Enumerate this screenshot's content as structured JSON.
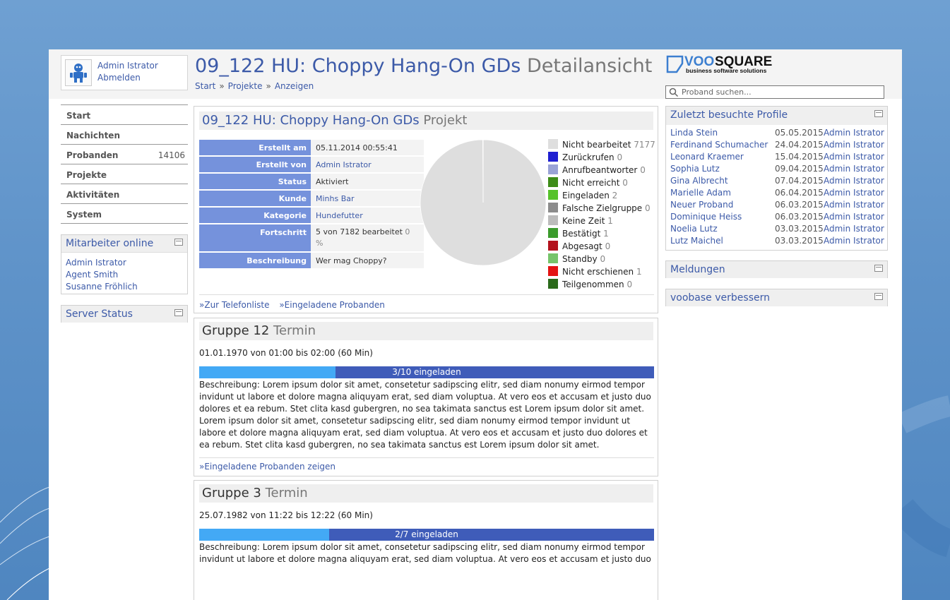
{
  "user": {
    "name": "Admin Istrator",
    "logout": "Abmelden"
  },
  "page": {
    "title": "09_122 HU: Choppy Hang-On GDs",
    "title_suffix": "Detailansicht"
  },
  "breadcrumb": [
    "Start",
    "Projekte",
    "Anzeigen"
  ],
  "breadcrumb_sep": "»",
  "logo": {
    "word_a": "VOO",
    "word_b": "SQUARE",
    "tagline": "business software solutions"
  },
  "search": {
    "placeholder": "Proband suchen..."
  },
  "nav": [
    {
      "label": "Start",
      "count": ""
    },
    {
      "label": "Nachichten",
      "count": ""
    },
    {
      "label": "Probanden",
      "count": "14106"
    },
    {
      "label": "Projekte",
      "count": ""
    },
    {
      "label": "Aktivitäten",
      "count": ""
    },
    {
      "label": "System",
      "count": ""
    }
  ],
  "online": {
    "title": "Mitarbeiter online",
    "users": [
      "Admin Istrator",
      "Agent Smith",
      "Susanne Fröhlich"
    ]
  },
  "server_status": {
    "title": "Server Status"
  },
  "project": {
    "name": "09_122 HU: Choppy Hang-On GDs",
    "suffix": "Projekt",
    "fields": [
      {
        "key": "Erstellt am",
        "value": "05.11.2014 00:55:41"
      },
      {
        "key": "Erstellt von",
        "value": "Admin Istrator"
      },
      {
        "key": "Status",
        "value": "Aktiviert"
      },
      {
        "key": "Kunde",
        "value": "Minhs Bar"
      },
      {
        "key": "Kategorie",
        "value": "Hundefutter"
      },
      {
        "key": "Fortschritt",
        "value": "5 von 7182 bearbeitet",
        "value_extra": "0 %"
      },
      {
        "key": "Beschreibung",
        "value": "Wer mag Choppy?"
      }
    ],
    "links": {
      "phone_list": "Zur Telefonliste",
      "invited": "Eingeladene Probanden"
    },
    "link_prefix": "»"
  },
  "chart_data": {
    "type": "pie",
    "slices": [
      {
        "label": "Nicht bearbeitet",
        "value": 7177,
        "color": "#dedede"
      },
      {
        "label": "Zurückrufen",
        "value": 0,
        "color": "#1f1fd1"
      },
      {
        "label": "Anrufbeantworter",
        "value": 0,
        "color": "#9aa3d6"
      },
      {
        "label": "Nicht erreicht",
        "value": 0,
        "color": "#3d8c18"
      },
      {
        "label": "Eingeladen",
        "value": 2,
        "color": "#56c22b"
      },
      {
        "label": "Falsche Zielgruppe",
        "value": 0,
        "color": "#8c8c8c"
      },
      {
        "label": "Keine Zeit",
        "value": 1,
        "color": "#bcbcbc"
      },
      {
        "label": "Bestätigt",
        "value": 1,
        "color": "#3b9b2c"
      },
      {
        "label": "Abgesagt",
        "value": 0,
        "color": "#b3121d"
      },
      {
        "label": "Standby",
        "value": 0,
        "color": "#76c46a"
      },
      {
        "label": "Nicht erschienen",
        "value": 1,
        "color": "#e31313"
      },
      {
        "label": "Teilgenommen",
        "value": 0,
        "color": "#2b6a1b"
      }
    ]
  },
  "groups": [
    {
      "name": "Gruppe 12",
      "suffix": "Termin",
      "date": "01.01.1970 von 01:00 bis 02:00 (60 Min)",
      "progress": {
        "invited": 3,
        "total": 10,
        "label": "3/10 eingeladen"
      },
      "description": "Beschreibung: Lorem ipsum dolor sit amet, consetetur sadipscing elitr, sed diam nonumy eirmod tempor invidunt ut labore et dolore magna aliquyam erat, sed diam voluptua. At vero eos et accusam et justo duo dolores et ea rebum. Stet clita kasd gubergren, no sea takimata sanctus est Lorem ipsum dolor sit amet. Lorem ipsum dolor sit amet, consetetur sadipscing elitr, sed diam nonumy eirmod tempor invidunt ut labore et dolore magna aliquyam erat, sed diam voluptua. At vero eos et accusam et justo duo dolores et ea rebum. Stet clita kasd gubergren, no sea takimata sanctus est Lorem ipsum dolor sit amet.",
      "link": "Eingeladene Probanden zeigen"
    },
    {
      "name": "Gruppe 3",
      "suffix": "Termin",
      "date": "25.07.1982 von 11:22 bis 12:22 (60 Min)",
      "progress": {
        "invited": 2,
        "total": 7,
        "label": "2/7 eingeladen"
      },
      "description": "Beschreibung: Lorem ipsum dolor sit amet, consetetur sadipscing elitr, sed diam nonumy eirmod tempor invidunt ut labore et dolore magna aliquyam erat, sed diam voluptua. At vero eos et accusam et justo duo"
    }
  ],
  "recent": {
    "title": "Zuletzt besuchte Profile",
    "rows": [
      {
        "name": "Linda Stein",
        "date": "05.05.2015",
        "by": "Admin Istrator"
      },
      {
        "name": "Ferdinand Schumacher",
        "date": "24.04.2015",
        "by": "Admin Istrator"
      },
      {
        "name": "Leonard Kraemer",
        "date": "15.04.2015",
        "by": "Admin Istrator"
      },
      {
        "name": "Sophia Lutz",
        "date": "09.04.2015",
        "by": "Admin Istrator"
      },
      {
        "name": "Gina Albrecht",
        "date": "07.04.2015",
        "by": "Admin Istrator"
      },
      {
        "name": "Marielle Adam",
        "date": "06.04.2015",
        "by": "Admin Istrator"
      },
      {
        "name": "Neuer Proband",
        "date": "06.03.2015",
        "by": "Admin Istrator"
      },
      {
        "name": "Dominique Heiss",
        "date": "06.03.2015",
        "by": "Admin Istrator"
      },
      {
        "name": "Noelia Lutz",
        "date": "03.03.2015",
        "by": "Admin Istrator"
      },
      {
        "name": "Lutz Maichel",
        "date": "03.03.2015",
        "by": "Admin Istrator"
      }
    ]
  },
  "messages": {
    "title": "Meldungen"
  },
  "improve": {
    "title": "voobase verbessern"
  }
}
